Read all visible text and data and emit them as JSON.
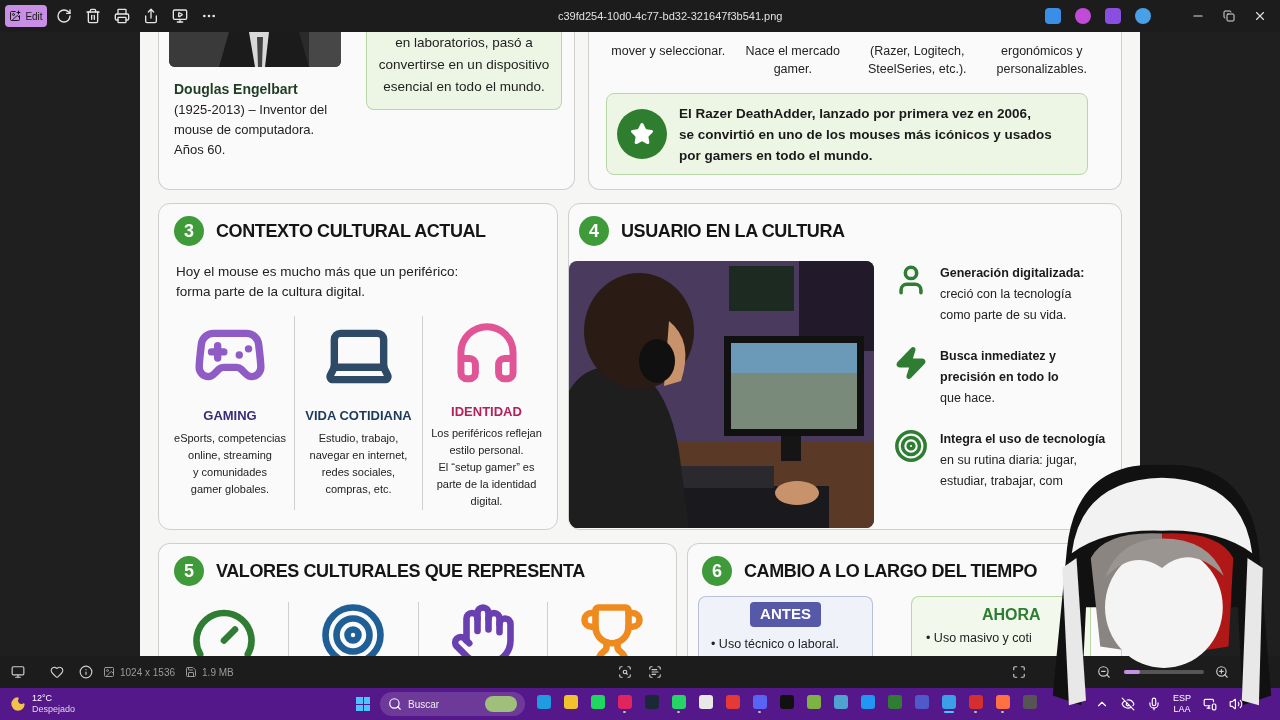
{
  "toolbar": {
    "edit_label": "Edit",
    "filename": "c39fd254-10d0-4c77-bd32-321647f3b541.png"
  },
  "origins": {
    "person_name": "Douglas Engelbart",
    "person_caption": "(1925-2013) – Inventor del\nmouse de computadora.\nAños 60.",
    "note": "en laboratorios, pasó a\nconvertirse en un dispositivo\nesencial en todo el mundo."
  },
  "evolution": {
    "columns": [
      "mover y seleccionar.",
      "Nace el mercado\ngamer.",
      "(Razer, Logitech,\nSteelSeries, etc.).",
      "ergonómicos y\npersonalizables."
    ],
    "callout": "El Razer DeathAdder, lanzado por primera vez en 2006,\nse convirtió en uno de los mouses más icónicos y usados\npor gamers en todo el mundo."
  },
  "culture": {
    "number": "3",
    "title": "CONTEXTO CULTURAL ACTUAL",
    "intro": "Hoy el mouse es mucho más que un periférico:\nforma parte de la cultura digital.",
    "items": [
      {
        "kind": "gamepad",
        "title": "GAMING",
        "color": "#3a2a78",
        "text": "eSports, competencias\nonline, streaming\ny comunidades\ngamer globales."
      },
      {
        "kind": "laptop",
        "title": "VIDA COTIDIANA",
        "color": "#1d3a5c",
        "text": "Estudio, trabajo,\nnavegar en internet,\nredes sociales,\ncompras, etc."
      },
      {
        "kind": "headphones",
        "title": "IDENTIDAD",
        "color": "#b3205c",
        "text": "Los periféricos reflejan\nestilo personal.\nEl “setup gamer” es\nparte de la identidad\ndigital."
      }
    ]
  },
  "user": {
    "number": "4",
    "title": "USUARIO EN LA CULTURA",
    "points": [
      {
        "kind": "person",
        "title": "Generación digitalizada:",
        "text": "creció con la tecnología\ncomo parte de su vida."
      },
      {
        "kind": "bolt",
        "title": "Busca inmediatez y\nprecisión en todo lo",
        "text": "que hace."
      },
      {
        "kind": "target",
        "title": "Integra el uso de tecnología",
        "text": "en su rutina diaria: jugar,\nestudiar, trabajar, com"
      }
    ]
  },
  "values": {
    "number": "5",
    "title": "VALORES CULTURALES QUE REPRESENTA",
    "items": [
      {
        "kind": "gauge"
      },
      {
        "kind": "target"
      },
      {
        "kind": "hand"
      },
      {
        "kind": "trophy"
      }
    ]
  },
  "change": {
    "number": "6",
    "title": "CAMBIO A LO LARGO DEL TIEMPO",
    "before": {
      "label": "ANTES",
      "bullets": [
        "• Uso técnico o laboral."
      ]
    },
    "after": {
      "label": "AHORA",
      "bullets": [
        "• Uso masivo y coti"
      ]
    }
  },
  "bottom_bar": {
    "dimensions": "1024 x 1536",
    "size": "1.9 MB",
    "zoom": {
      "level": 0.2
    }
  },
  "taskbar": {
    "weather": {
      "temp": "12°C",
      "condition": "Despejado"
    },
    "search_placeholder": "Buscar",
    "apps": [
      {
        "color": "#1f9be0",
        "open": false
      },
      {
        "color": "#f2c12e",
        "open": false
      },
      {
        "color": "#1ed760",
        "open": false
      },
      {
        "color": "#e0245e",
        "open": true
      },
      {
        "color": "#1b2838",
        "open": false
      },
      {
        "color": "#25d366",
        "open": true
      },
      {
        "color": "#e8e8e8",
        "open": false
      },
      {
        "color": "#e53935",
        "open": false
      },
      {
        "color": "#5865f2",
        "open": true
      },
      {
        "color": "#111111",
        "open": false
      },
      {
        "color": "#7cb342",
        "open": false
      },
      {
        "color": "#4fa3d1",
        "open": false
      },
      {
        "color": "#2196f3",
        "open": false
      },
      {
        "color": "#2e7d32",
        "open": false
      },
      {
        "color": "#5059c9",
        "open": false
      },
      {
        "color": "#3aa0e8",
        "open": true,
        "selected": true
      },
      {
        "color": "#d32f2f",
        "open": true
      },
      {
        "color": "#ff7043",
        "open": true
      },
      {
        "color": "#555555",
        "open": false
      }
    ],
    "language": [
      "ESP",
      "LAA"
    ]
  }
}
